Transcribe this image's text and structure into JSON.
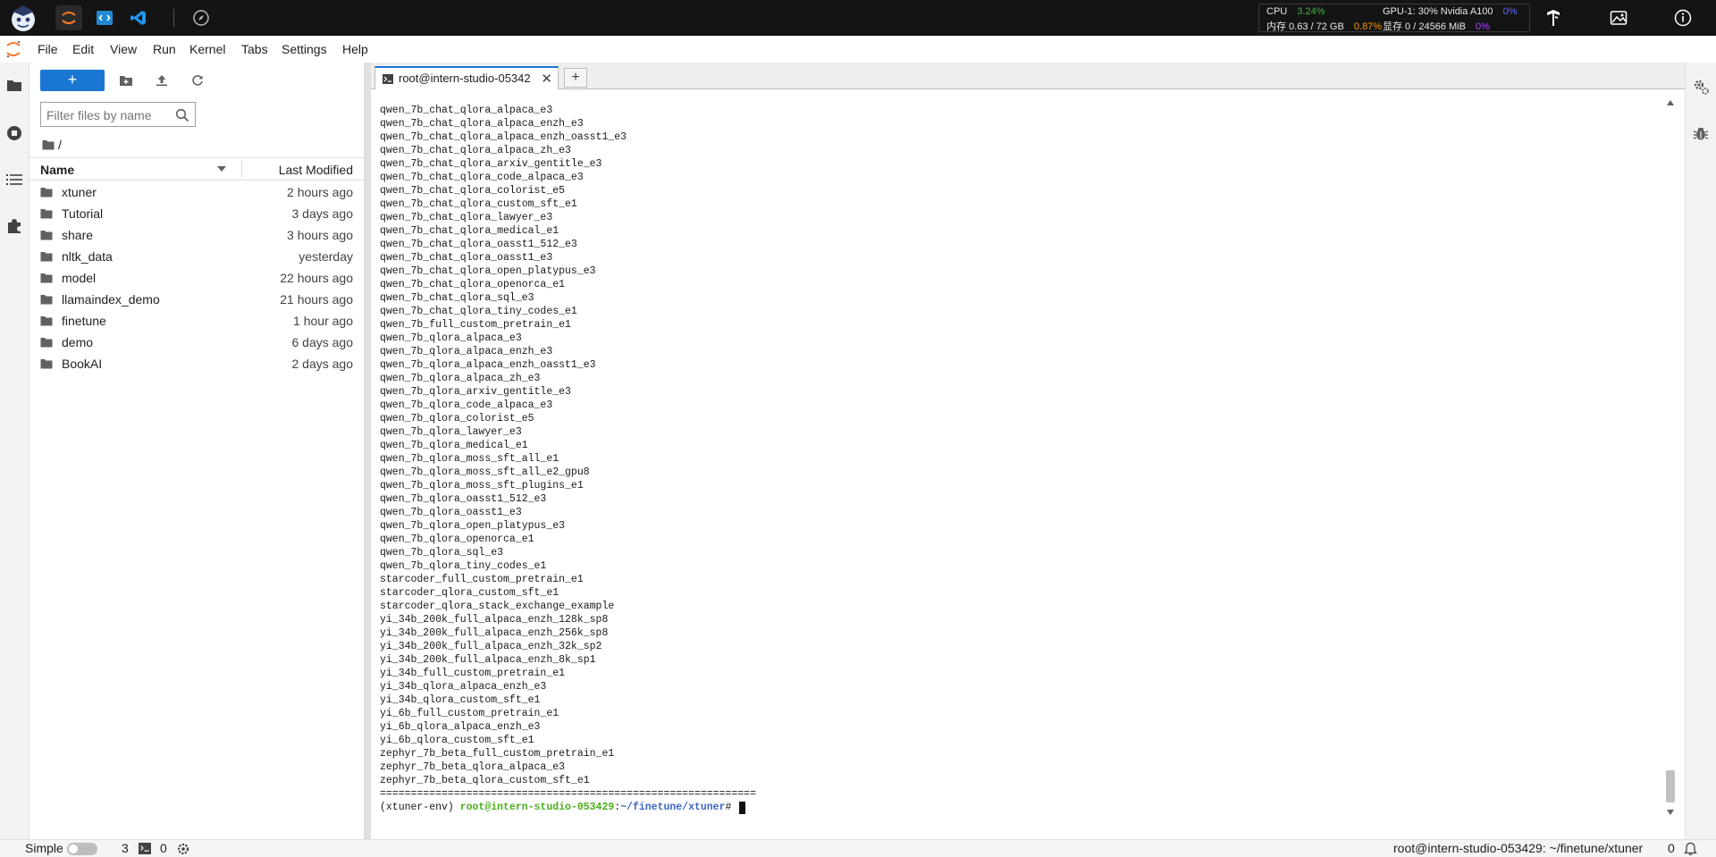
{
  "topbar": {
    "stats": {
      "cpu_label": "CPU",
      "cpu_value": "3.24%",
      "gpu_label": "GPU-1: 30% Nvidia A100",
      "gpu_value": "0%",
      "mem_label": "内存 0.63 / 72 GB",
      "mem_value": "0.87%",
      "vram_label": "显存 0 / 24566 MiB",
      "vram_value": "0%"
    },
    "colors": {
      "cpu": "#4caf50",
      "mem": "#ff9800",
      "gpu": "#3f51ff",
      "vram": "#b040ff"
    }
  },
  "menubar": {
    "items": [
      "File",
      "Edit",
      "View",
      "Run",
      "Kernel",
      "Tabs",
      "Settings",
      "Help"
    ]
  },
  "filebrowser": {
    "new_label": "+",
    "filter_placeholder": "Filter files by name",
    "breadcrumb": "/",
    "columns": {
      "name": "Name",
      "modified": "Last Modified"
    },
    "items": [
      {
        "name": "xtuner",
        "modified": "2 hours ago"
      },
      {
        "name": "Tutorial",
        "modified": "3 days ago"
      },
      {
        "name": "share",
        "modified": "3 hours ago"
      },
      {
        "name": "nltk_data",
        "modified": "yesterday"
      },
      {
        "name": "model",
        "modified": "22 hours ago"
      },
      {
        "name": "llamaindex_demo",
        "modified": "21 hours ago"
      },
      {
        "name": "finetune",
        "modified": "1 hour ago"
      },
      {
        "name": "demo",
        "modified": "6 days ago"
      },
      {
        "name": "BookAI",
        "modified": "2 days ago"
      }
    ]
  },
  "tabs": [
    {
      "label": "root@intern-studio-05342",
      "close": "✕"
    }
  ],
  "tab_add": "+",
  "terminal": {
    "lines": [
      "qwen_7b_chat_qlora_alpaca_e3",
      "qwen_7b_chat_qlora_alpaca_enzh_e3",
      "qwen_7b_chat_qlora_alpaca_enzh_oasst1_e3",
      "qwen_7b_chat_qlora_alpaca_zh_e3",
      "qwen_7b_chat_qlora_arxiv_gentitle_e3",
      "qwen_7b_chat_qlora_code_alpaca_e3",
      "qwen_7b_chat_qlora_colorist_e5",
      "qwen_7b_chat_qlora_custom_sft_e1",
      "qwen_7b_chat_qlora_lawyer_e3",
      "qwen_7b_chat_qlora_medical_e1",
      "qwen_7b_chat_qlora_oasst1_512_e3",
      "qwen_7b_chat_qlora_oasst1_e3",
      "qwen_7b_chat_qlora_open_platypus_e3",
      "qwen_7b_chat_qlora_openorca_e1",
      "qwen_7b_chat_qlora_sql_e3",
      "qwen_7b_chat_qlora_tiny_codes_e1",
      "qwen_7b_full_custom_pretrain_e1",
      "qwen_7b_qlora_alpaca_e3",
      "qwen_7b_qlora_alpaca_enzh_e3",
      "qwen_7b_qlora_alpaca_enzh_oasst1_e3",
      "qwen_7b_qlora_alpaca_zh_e3",
      "qwen_7b_qlora_arxiv_gentitle_e3",
      "qwen_7b_qlora_code_alpaca_e3",
      "qwen_7b_qlora_colorist_e5",
      "qwen_7b_qlora_lawyer_e3",
      "qwen_7b_qlora_medical_e1",
      "qwen_7b_qlora_moss_sft_all_e1",
      "qwen_7b_qlora_moss_sft_all_e2_gpu8",
      "qwen_7b_qlora_moss_sft_plugins_e1",
      "qwen_7b_qlora_oasst1_512_e3",
      "qwen_7b_qlora_oasst1_e3",
      "qwen_7b_qlora_open_platypus_e3",
      "qwen_7b_qlora_openorca_e1",
      "qwen_7b_qlora_sql_e3",
      "qwen_7b_qlora_tiny_codes_e1",
      "starcoder_full_custom_pretrain_e1",
      "starcoder_qlora_custom_sft_e1",
      "starcoder_qlora_stack_exchange_example",
      "yi_34b_200k_full_alpaca_enzh_128k_sp8",
      "yi_34b_200k_full_alpaca_enzh_256k_sp8",
      "yi_34b_200k_full_alpaca_enzh_32k_sp2",
      "yi_34b_200k_full_alpaca_enzh_8k_sp1",
      "yi_34b_full_custom_pretrain_e1",
      "yi_34b_qlora_alpaca_enzh_e3",
      "yi_34b_qlora_custom_sft_e1",
      "yi_6b_full_custom_pretrain_e1",
      "yi_6b_qlora_alpaca_enzh_e3",
      "yi_6b_qlora_custom_sft_e1",
      "zephyr_7b_beta_full_custom_pretrain_e1",
      "zephyr_7b_beta_qlora_alpaca_e3",
      "zephyr_7b_beta_qlora_custom_sft_e1",
      "============================================================="
    ],
    "prompt": {
      "env": "(xtuner-env) ",
      "user": "root@intern-studio-053429",
      "sep": ":",
      "path": "~/finetune/xtuner",
      "suffix": "# "
    }
  },
  "statusbar": {
    "mode_label": "Simple",
    "kernels": "3",
    "terminals": "0",
    "right_text": "root@intern-studio-053429: ~/finetune/xtuner",
    "notifications": "0"
  }
}
